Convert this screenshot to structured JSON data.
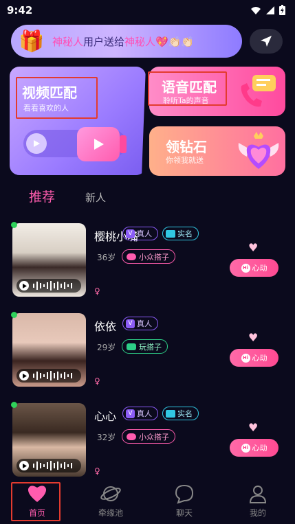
{
  "status": {
    "time": "9:42"
  },
  "banner": {
    "name1": "神秘人",
    "mid": "用户送给",
    "name2": "神秘人",
    "emoji": "💖👏🏻👏🏻"
  },
  "cards": {
    "video": {
      "title": "视频匹配",
      "sub": "看看喜欢的人"
    },
    "voice": {
      "title": "语音匹配",
      "sub": "聆听Ta的声音"
    },
    "diamond": {
      "title": "领钻石",
      "sub": "你领我就送"
    }
  },
  "tabs": {
    "recommend": "推荐",
    "new": "新人"
  },
  "users": [
    {
      "name": "樱桃小嘴",
      "real": "真人",
      "verified": "实名",
      "age": "36岁",
      "tag": "小众搭子",
      "tag_style": "pink",
      "like": "心动",
      "gender": "♀"
    },
    {
      "name": "依依",
      "real": "真人",
      "verified": "",
      "age": "29岁",
      "tag": "玩搭子",
      "tag_style": "green",
      "like": "心动",
      "gender": "♀"
    },
    {
      "name": "心心",
      "real": "真人",
      "verified": "实名",
      "age": "32岁",
      "tag": "小众搭子",
      "tag_style": "pink",
      "like": "心动",
      "gender": "♀"
    }
  ],
  "nav": {
    "home": "首页",
    "pool": "牵缘池",
    "chat": "聊天",
    "mine": "我的"
  },
  "colors": {
    "accent": "#ff5cae",
    "online": "#2fd25a"
  }
}
